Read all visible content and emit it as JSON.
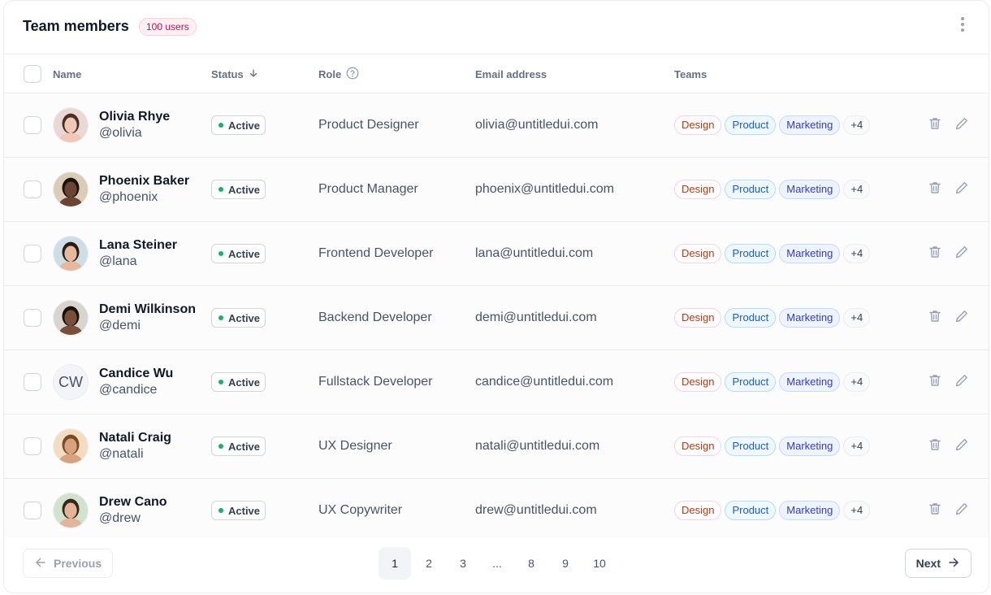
{
  "header": {
    "title": "Team members",
    "count_badge": "100 users"
  },
  "columns": {
    "name": "Name",
    "status": "Status",
    "role": "Role",
    "email": "Email address",
    "teams": "Teams"
  },
  "status_label": "Active",
  "team_tags": {
    "design": "Design",
    "product": "Product",
    "marketing": "Marketing",
    "more": "+4"
  },
  "colors": {
    "active_dot": "#17b26a",
    "users_badge_text": "#c01048",
    "product_tag": "#175cd3",
    "marketing_tag": "#3538cd",
    "design_tag": "#b93815"
  },
  "members": [
    {
      "name": "Olivia Rhye",
      "handle": "@olivia",
      "role": "Product Designer",
      "email": "olivia@untitledui.com",
      "avatar": "photo",
      "tone": "#e9d8d6",
      "skin": "#f0c9b6",
      "hair": "#4a2e22"
    },
    {
      "name": "Phoenix Baker",
      "handle": "@phoenix",
      "role": "Product Manager",
      "email": "phoenix@untitledui.com",
      "avatar": "photo",
      "tone": "#d9cdb7",
      "skin": "#6b4532",
      "hair": "#1c120d"
    },
    {
      "name": "Lana Steiner",
      "handle": "@lana",
      "role": "Frontend Developer",
      "email": "lana@untitledui.com",
      "avatar": "photo",
      "tone": "#cfdde6",
      "skin": "#e6b99d",
      "hair": "#2a1b14"
    },
    {
      "name": "Demi Wilkinson",
      "handle": "@demi",
      "role": "Backend Developer",
      "email": "demi@untitledui.com",
      "avatar": "photo",
      "tone": "#d8d4d0",
      "skin": "#7a4f3a",
      "hair": "#1b110c"
    },
    {
      "name": "Candice Wu",
      "handle": "@candice",
      "role": "Fullstack Developer",
      "email": "candice@untitledui.com",
      "avatar": "initials",
      "initials": "CW"
    },
    {
      "name": "Natali Craig",
      "handle": "@natali",
      "role": "UX Designer",
      "email": "natali@untitledui.com",
      "avatar": "photo",
      "tone": "#f2dcc2",
      "skin": "#d9a27e",
      "hair": "#7a4a24"
    },
    {
      "name": "Drew Cano",
      "handle": "@drew",
      "role": "UX Copywriter",
      "email": "drew@untitledui.com",
      "avatar": "photo",
      "tone": "#cfe3cf",
      "skin": "#e4b49a",
      "hair": "#3b2519"
    }
  ],
  "pagination": {
    "previous": "Previous",
    "next": "Next",
    "pages": [
      "1",
      "2",
      "3",
      "...",
      "8",
      "9",
      "10"
    ],
    "current": "1"
  }
}
